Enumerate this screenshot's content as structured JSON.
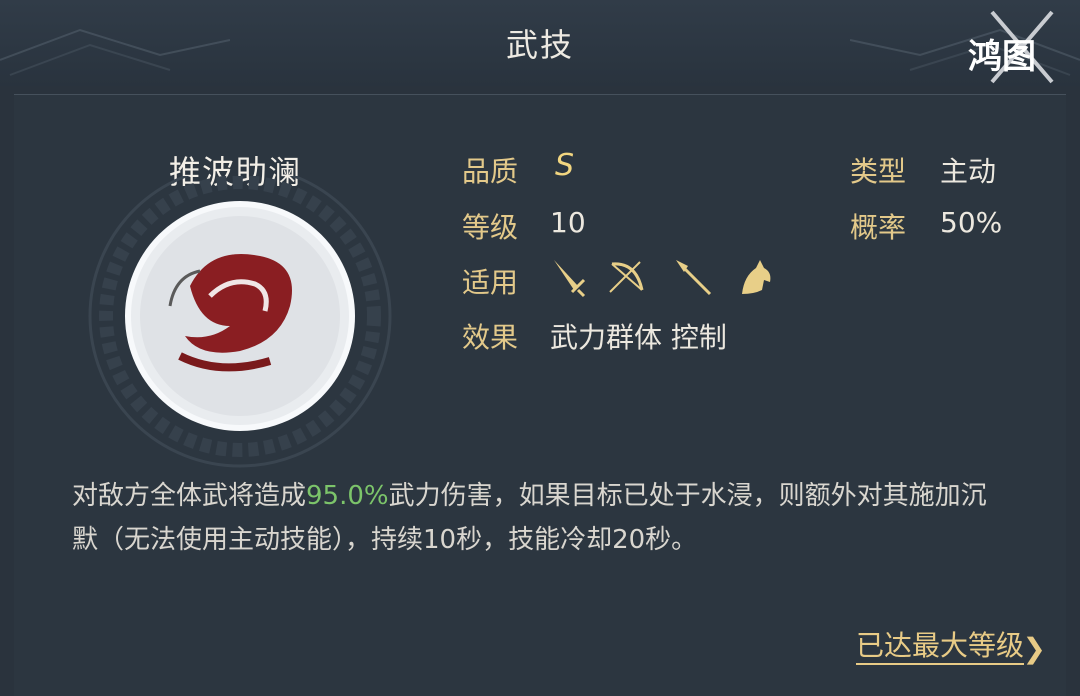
{
  "header": {
    "title": "武技",
    "logo_text": "鸿图"
  },
  "skill": {
    "name": "推波助澜",
    "quality_label": "品质",
    "quality_value": "S",
    "level_label": "等级",
    "level_value": "10",
    "applicable_label": "适用",
    "applicable_icons": [
      "sword-icon",
      "bow-icon",
      "spear-icon",
      "horse-icon"
    ],
    "effect_label": "效果",
    "effect_value": "武力群体 控制",
    "type_label": "类型",
    "type_value": "主动",
    "chance_label": "概率",
    "chance_value": "50%"
  },
  "description": {
    "prefix": "对敌方全体武将造成",
    "highlight": "95.0%",
    "suffix": "武力伤害，如果目标已处于水浸，则额外对其施加沉默（无法使用主动技能），持续10秒，技能冷却20秒。"
  },
  "footer": {
    "max_level_label": "已达最大等级",
    "chevron": "❯"
  },
  "colors": {
    "accent_gold": "#e3c98a",
    "highlight_green": "#7cc46a",
    "background": "#2a333d"
  }
}
